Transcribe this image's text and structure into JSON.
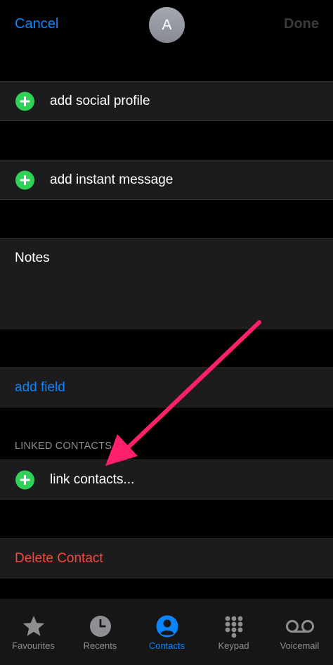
{
  "nav": {
    "cancel_label": "Cancel",
    "avatar_initial": "A",
    "done_label": "Done"
  },
  "rows": {
    "social_profile": "add social profile",
    "instant_message": "add instant message",
    "notes_label": "Notes",
    "add_field": "add field",
    "linked_contacts_header": "LINKED CONTACTS",
    "link_contacts": "link contacts...",
    "delete_contact": "Delete Contact"
  },
  "tabbar": {
    "tabs": [
      {
        "label": "Favourites",
        "icon": "star-icon"
      },
      {
        "label": "Recents",
        "icon": "clock-icon"
      },
      {
        "label": "Contacts",
        "icon": "person-circle-icon",
        "active": true
      },
      {
        "label": "Keypad",
        "icon": "keypad-icon"
      },
      {
        "label": "Voicemail",
        "icon": "voicemail-icon"
      }
    ]
  },
  "colors": {
    "accent_blue": "#0a84ff",
    "add_green": "#30d158",
    "destructive_red": "#ff453a",
    "annotation_pink": "#ff1f6b"
  }
}
